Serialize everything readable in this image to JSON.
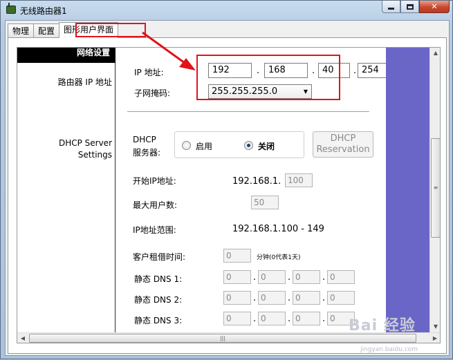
{
  "window": {
    "title": "无线路由器1"
  },
  "tabs": [
    {
      "label": "物理"
    },
    {
      "label": "配置"
    },
    {
      "label": "图形用户界面"
    }
  ],
  "left": {
    "section_header": "网络设置",
    "router_ip_label": "路由器 IP 地址",
    "dhcp_label_1": "DHCP Server",
    "dhcp_label_2": "Settings"
  },
  "router_ip": {
    "ip_label": "IP 地址:",
    "octets": [
      "192",
      "168",
      "40",
      "254"
    ],
    "subnet_label": "子网掩码:",
    "subnet_value": "255.255.255.0"
  },
  "dhcp": {
    "server_label_1": "DHCP",
    "server_label_2": "服务器:",
    "enable_label": "启用",
    "disable_label": "关闭",
    "selected": "关闭",
    "reservation_1": "DHCP",
    "reservation_2": "Reservation",
    "start_ip_label": "开始IP地址:",
    "start_ip_prefix": "192.168.1.",
    "start_ip_last": "100",
    "max_users_label": "最大用户数:",
    "max_users": "50",
    "range_label": "IP地址范围:",
    "range_value": "192.168.1.100 - 149",
    "lease_label": "客户租借时间:",
    "lease_value": "0",
    "lease_unit": "分钟(0代表1天)",
    "dns1_label": "静态 DNS 1:",
    "dns2_label": "静态 DNS 2:",
    "dns3_label": "静态 DNS 3:",
    "dns1": [
      "0",
      "0",
      "0",
      "0"
    ],
    "dns2": [
      "0",
      "0",
      "0",
      "0"
    ],
    "dns3": [
      "0",
      "0",
      "0",
      "0"
    ]
  },
  "watermark": {
    "brand": "Bai 经验",
    "url": "jingyan.baidu.com"
  },
  "colors": {
    "annotation": "#e0121a",
    "side_panel": "#6a66c8"
  },
  "icons": {
    "app": "router-icon",
    "minimize": "minimize-icon",
    "maximize": "maximize-icon",
    "close": "close-icon"
  }
}
